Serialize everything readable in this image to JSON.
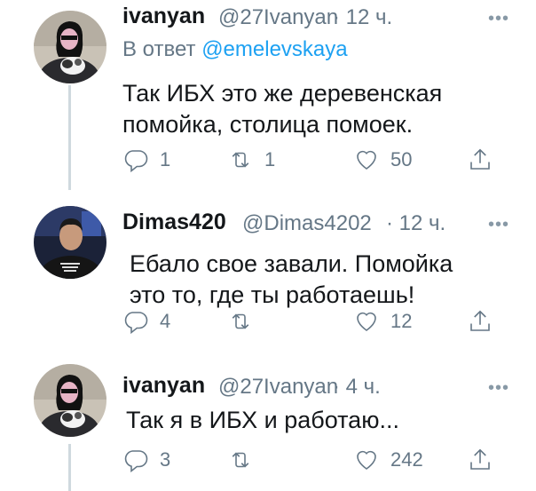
{
  "tweets": [
    {
      "name": "ivanyan",
      "handle": "@27Ivanyan",
      "time": "· 12 ч.",
      "reply_prefix": "В ответ",
      "reply_mention": "@emelevskaya",
      "text": "Так ИБХ это же деревенская\nпомойка, столица помоек.",
      "replies": "1",
      "retweets": "1",
      "likes": "50"
    },
    {
      "name": "Dimas420",
      "handle": "@Dimas4202",
      "time": "· 12 ч.",
      "text": "Ебало свое завали. Помойка\nэто то, где ты работаешь!",
      "replies": "4",
      "retweets": "",
      "likes": "12"
    },
    {
      "name": "ivanyan",
      "handle": "@27Ivanyan",
      "time": "· 4 ч.",
      "text": "Так я в ИБХ и работаю...",
      "replies": "3",
      "retweets": "",
      "likes": "242"
    }
  ],
  "more_label": "•••",
  "colors": {
    "text": "#14171a",
    "muted": "#657786",
    "link": "#1da1f2",
    "thread_line": "#cfd9de"
  },
  "icons": [
    "reply-icon",
    "retweet-icon",
    "like-icon",
    "share-icon",
    "more-icon"
  ]
}
